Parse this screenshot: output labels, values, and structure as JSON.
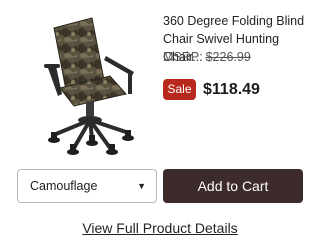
{
  "product": {
    "title": "360 Degree Folding Blind Chair Swivel Hunting Chair...",
    "msrp_label": "MSRP:",
    "msrp_value": "$226.99",
    "sale_badge": "Sale",
    "price": "$118.49",
    "image_icon": "hunting-chair-image"
  },
  "options": {
    "selected": "Camouflage",
    "caret_glyph": "▼"
  },
  "actions": {
    "add_to_cart": "Add to Cart",
    "view_details": "View Full Product Details"
  },
  "colors": {
    "sale": "#b8281c",
    "button": "#3c2b2a"
  }
}
